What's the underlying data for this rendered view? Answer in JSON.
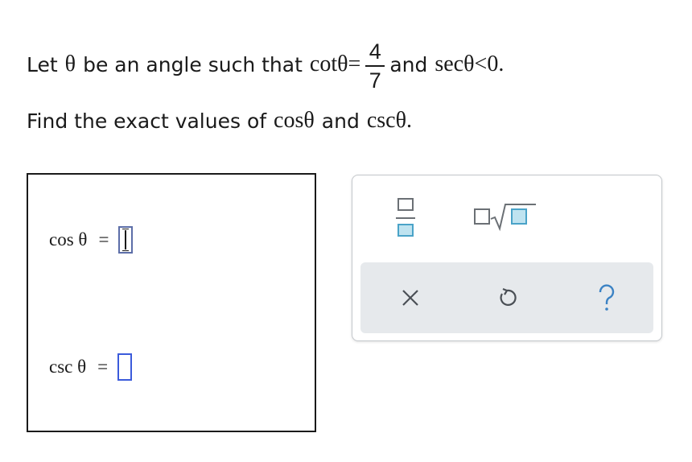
{
  "problem": {
    "line1_prefix": "Let",
    "theta": "θ",
    "line1_mid": "be an angle such that",
    "cot_expr": "cotθ=",
    "numerator": "4",
    "denominator": "7",
    "and_word": "and",
    "sec_expr": "secθ<0.",
    "line2_prefix": "Find the exact values of",
    "cos_expr": "cosθ",
    "and_word2": "and",
    "csc_expr": "cscθ."
  },
  "answers": {
    "cos_label": "cos θ",
    "csc_label": "csc θ",
    "equals": "="
  },
  "colors": {
    "slot_border": "#3b5bdb",
    "palette_icon_gray": "#6b7075",
    "palette_icon_blue": "#4aa3c8",
    "help_blue": "#3b82c4"
  },
  "icons": {
    "fraction": "fraction-template-icon",
    "sqrt": "sqrt-template-icon",
    "clear": "close-icon",
    "undo": "undo-icon",
    "help": "question-mark-icon"
  }
}
